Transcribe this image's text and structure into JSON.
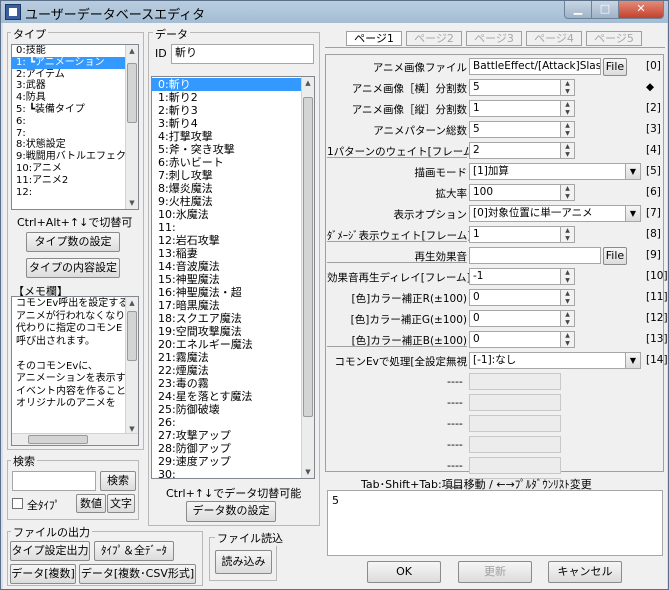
{
  "window": {
    "title": "ユーザーデータベースエディタ"
  },
  "type_group": {
    "label": "タイプ",
    "items": [
      "0:技能",
      "1: ┗アニメーション",
      "2:アイテム",
      "3:武器",
      "4:防具",
      "5: ┗装備タイプ",
      "6:",
      "7:",
      "8:状態設定",
      "9:戦闘用バトルエフェクト",
      "10:アニメ",
      "11:アニメ2",
      "12:"
    ],
    "selected_index": 1,
    "switch_hint": "Ctrl+Alt+↑↓で切替可",
    "type_count_button": "タイプ数の設定",
    "type_content_button": "タイプの内容設定"
  },
  "memo": {
    "label": "【メモ欄】",
    "lines": [
      "コモンEv呼出を設定する",
      "アニメが行われなくなり、",
      "代わりに指定のコモンE",
      "呼び出されます。",
      "",
      "そのコモンEvに、",
      "アニメーションを表示す",
      "イベント内容を作ること",
      "オリジナルのアニメを"
    ]
  },
  "search": {
    "label": "検索",
    "value": "",
    "button": "検索",
    "all_types_label": "全ﾀｲﾌﾟ",
    "numeric_button": "数値",
    "text_button": "文字"
  },
  "file_output": {
    "label": "ファイルの出力",
    "type_settings_button": "タイプ設定出力",
    "type_all_button": "ﾀｲﾌﾟ＆全ﾃﾞｰﾀ",
    "data_multi_button": "データ[複数]",
    "data_csv_button": "データ[複数･CSV形式]"
  },
  "file_read": {
    "label": "ファイル読込",
    "button": "読み込み"
  },
  "data_group": {
    "label": "データ",
    "id_label": "ID",
    "id_value": "斬り",
    "items": [
      "0:斬り",
      "1:斬り2",
      "2:斬り3",
      "3:斬り4",
      "4:打撃攻撃",
      "5:斧・突き攻撃",
      "6:赤いビート",
      "7:刺し攻撃",
      "8:爆炎魔法",
      "9:火柱魔法",
      "10:氷魔法",
      "11:",
      "12:岩石攻撃",
      "13:稲妻",
      "14:音波魔法",
      "15:神聖魔法",
      "16:神聖魔法・超",
      "17:暗黒魔法",
      "18:スクエア魔法",
      "19:空間攻撃魔法",
      "20:エネルギー魔法",
      "21:霧魔法",
      "22:煙魔法",
      "23:毒の霧",
      "24:星を落とす魔法",
      "25:防御破壊",
      "26:",
      "27:攻撃アップ",
      "28:防御アップ",
      "29:速度アップ",
      "30:"
    ],
    "selected_index": 0,
    "switch_hint": "Ctrl+↑↓でデータ切替可能",
    "data_count_button": "データ数の設定"
  },
  "pages": {
    "tabs": [
      "ページ1",
      "ページ2",
      "ページ3",
      "ページ4",
      "ページ5"
    ],
    "active_index": 0
  },
  "fields": [
    {
      "label": "アニメ画像ファイル",
      "value": "BattleEffect/[Attack]Slash",
      "index": "[0]",
      "kind": "file",
      "button": "File"
    },
    {
      "label": "アニメ画像［横］分割数",
      "value": "5",
      "index": "◆",
      "kind": "spin"
    },
    {
      "label": "アニメ画像［縦］分割数",
      "value": "1",
      "index": "[2]",
      "kind": "spin"
    },
    {
      "label": "アニメパターン総数",
      "value": "5",
      "index": "[3]",
      "kind": "spin"
    },
    {
      "label": "1パターンのウェイト[フレーム]",
      "value": "2",
      "index": "[4]",
      "kind": "spin"
    },
    {
      "label": "描画モード",
      "value": "[1]加算",
      "index": "[5]",
      "kind": "combo"
    },
    {
      "label": "拡大率",
      "value": "100",
      "index": "[6]",
      "kind": "spin"
    },
    {
      "label": "表示オプション",
      "value": "[0]対象位置に単一アニメ",
      "index": "[7]",
      "kind": "combo"
    },
    {
      "label": "ﾀﾞﾒｰｼﾞ表示ウェイト[フレーム]",
      "value": "1",
      "index": "[8]",
      "kind": "spin"
    },
    {
      "label": "再生効果音",
      "value": "",
      "index": "[9]",
      "kind": "file",
      "button": "File"
    },
    {
      "label": "効果音再生ディレイ[フレーム]",
      "value": "-1",
      "index": "[10]",
      "kind": "spin"
    },
    {
      "label": "[色]カラー補正R(±100)",
      "value": "0",
      "index": "[11]",
      "kind": "spin"
    },
    {
      "label": "[色]カラー補正G(±100)",
      "value": "0",
      "index": "[12]",
      "kind": "spin"
    },
    {
      "label": "[色]カラー補正B(±100)",
      "value": "0",
      "index": "[13]",
      "kind": "spin"
    },
    {
      "label": "コモンEvで処理[全設定無視",
      "value": "[-1]:なし",
      "index": "[14]",
      "kind": "combo"
    }
  ],
  "empty_rows": [
    "----",
    "----",
    "----",
    "----",
    "----",
    "----"
  ],
  "help_text": "Tab･Shift+Tab:項目移動 / ←→ﾌﾟﾙﾀﾞｳﾝﾘｽﾄ変更",
  "edit_value": "5",
  "buttons": {
    "ok": "OK",
    "apply": "更新",
    "cancel": "キャンセル"
  },
  "colors": {
    "selection": "#3399ff",
    "titlebar": "#a4bdd4"
  }
}
